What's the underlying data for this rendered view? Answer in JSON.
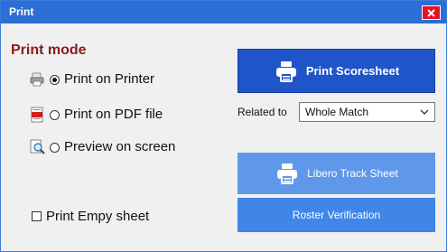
{
  "window": {
    "title": "Print",
    "close_glyph": "✕"
  },
  "print_mode": {
    "heading": "Print mode",
    "options": [
      {
        "label": "Print on Printer",
        "icon": "printer-icon",
        "checked": true
      },
      {
        "label": "Print on PDF file",
        "icon": "pdf-icon",
        "checked": false
      },
      {
        "label": "Preview on screen",
        "icon": "preview-icon",
        "checked": false
      }
    ]
  },
  "empty_sheet": {
    "label": "Print Empy sheet",
    "checked": false
  },
  "actions": {
    "print_scoresheet": "Print Scoresheet",
    "related_to_label": "Related to",
    "related_to_value": "Whole Match",
    "libero_track_sheet": "Libero Track Sheet",
    "roster_verification": "Roster Verification"
  },
  "colors": {
    "title_bar": "#2b6fd6",
    "heading": "#8b1a1a",
    "primary_button": "#1f55c8",
    "secondary_button": "#5f98ea"
  }
}
